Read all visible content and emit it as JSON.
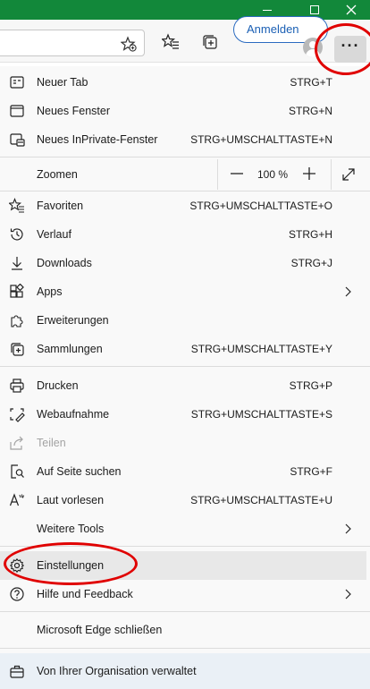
{
  "titlebar": {
    "color": "#12883a"
  },
  "toolbar": {
    "signin_label": "Anmelden",
    "more_label": "···"
  },
  "menu": {
    "items_group1": [
      {
        "label": "Neuer Tab",
        "shortcut": "STRG+T",
        "icon": "new-tab-icon"
      },
      {
        "label": "Neues Fenster",
        "shortcut": "STRG+N",
        "icon": "new-window-icon"
      },
      {
        "label": "Neues InPrivate-Fenster",
        "shortcut": "STRG+UMSCHALTTASTE+N",
        "icon": "inprivate-icon"
      }
    ],
    "zoom": {
      "label": "Zoomen",
      "value": "100 %",
      "minus": "−",
      "plus": "+"
    },
    "items_group2": [
      {
        "label": "Favoriten",
        "shortcut": "STRG+UMSCHALTTASTE+O",
        "icon": "favorites-icon"
      },
      {
        "label": "Verlauf",
        "shortcut": "STRG+H",
        "icon": "history-icon"
      },
      {
        "label": "Downloads",
        "shortcut": "STRG+J",
        "icon": "download-icon"
      },
      {
        "label": "Apps",
        "shortcut": "",
        "icon": "apps-icon"
      },
      {
        "label": "Erweiterungen",
        "shortcut": "",
        "icon": "extensions-icon"
      },
      {
        "label": "Sammlungen",
        "shortcut": "STRG+UMSCHALTTASTE+Y",
        "icon": "collections-icon"
      }
    ],
    "items_group3": [
      {
        "label": "Drucken",
        "shortcut": "STRG+P",
        "icon": "print-icon"
      },
      {
        "label": "Webaufnahme",
        "shortcut": "STRG+UMSCHALTTASTE+S",
        "icon": "web-capture-icon"
      },
      {
        "label": "Teilen",
        "shortcut": "",
        "icon": "share-icon"
      },
      {
        "label": "Auf Seite suchen",
        "shortcut": "STRG+F",
        "icon": "find-icon"
      },
      {
        "label": "Laut vorlesen",
        "shortcut": "STRG+UMSCHALTTASTE+U",
        "icon": "read-aloud-icon"
      },
      {
        "label": "Weitere Tools",
        "shortcut": "",
        "icon": ""
      }
    ],
    "items_group4": [
      {
        "label": "Einstellungen",
        "shortcut": "",
        "icon": "settings-icon"
      },
      {
        "label": "Hilfe und Feedback",
        "shortcut": "",
        "icon": "help-icon"
      }
    ],
    "close_label": "Microsoft Edge schließen",
    "org_label": "Von Ihrer Organisation verwaltet"
  }
}
